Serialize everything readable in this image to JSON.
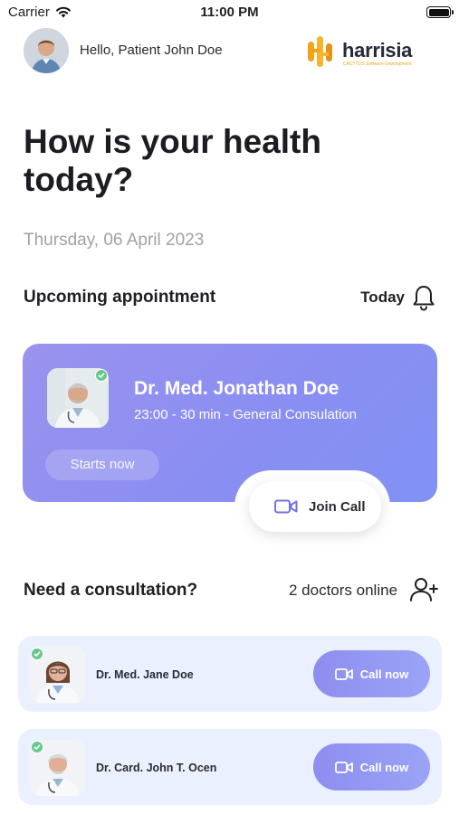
{
  "status_bar": {
    "carrier": "Carrier",
    "time": "11:00 PM"
  },
  "header": {
    "greeting": "Hello, Patient John Doe",
    "brand_name": "harrisia",
    "brand_tagline": "CACTTUS Software Development"
  },
  "headline": "How is your health today?",
  "date": "Thursday, 06 April 2023",
  "upcoming": {
    "title": "Upcoming appointment",
    "filter_label": "Today",
    "card": {
      "doctor_name": "Dr. Med. Jonathan Doe",
      "details": "23:00 - 30 min - General Consulation",
      "status_label": "Starts now",
      "join_label": "Join Call"
    }
  },
  "consultation": {
    "title": "Need a consultation?",
    "online_label": "2 doctors online",
    "doctors": [
      {
        "name": "Dr. Med. Jane Doe",
        "call_label": "Call now"
      },
      {
        "name": "Dr. Card. John T. Ocen",
        "call_label": "Call now"
      }
    ]
  },
  "colors": {
    "accent": "#8a8ef2",
    "online_check": "#66c88a",
    "brand_orange": "#f3a21a",
    "row_background": "#eaf0fe"
  }
}
